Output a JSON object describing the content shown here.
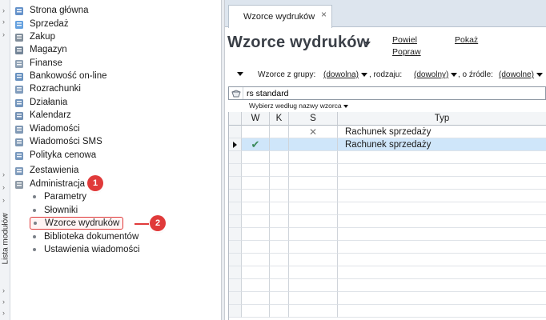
{
  "side_strip": {
    "label": "Lista modułów"
  },
  "modules": [
    {
      "label": "Strona główna",
      "icon": "home-icon",
      "color": "#4a7fc1"
    },
    {
      "label": "Sprzedaż",
      "icon": "sales-icon",
      "color": "#4a90d9"
    },
    {
      "label": "Zakup",
      "icon": "purchase-icon",
      "color": "#6b7a8a"
    },
    {
      "label": "Magazyn",
      "icon": "warehouse-icon",
      "color": "#5a6f85"
    },
    {
      "label": "Finanse",
      "icon": "finance-icon",
      "color": "#7a8fa6"
    },
    {
      "label": "Bankowość on-line",
      "icon": "bank-icon",
      "color": "#4f7fb5"
    },
    {
      "label": "Rozrachunki",
      "icon": "settlements-icon",
      "color": "#6a8bb0"
    },
    {
      "label": "Działania",
      "icon": "actions-icon",
      "color": "#5b82b0"
    },
    {
      "label": "Kalendarz",
      "icon": "calendar-icon",
      "color": "#5a7ea8"
    },
    {
      "label": "Wiadomości",
      "icon": "messages-icon",
      "color": "#6a87a8"
    },
    {
      "label": "Wiadomości SMS",
      "icon": "sms-icon",
      "color": "#6a87a8"
    },
    {
      "label": "Polityka cenowa",
      "icon": "pricing-icon",
      "color": "#5f86b3"
    },
    {
      "label": "Zestawienia",
      "icon": "reports-icon",
      "color": "#6a8bb0"
    },
    {
      "label": "Administracja",
      "icon": "admin-icon",
      "color": "#7a8898"
    }
  ],
  "admin_subitems": [
    "Parametry",
    "Słowniki",
    "Wzorce wydruków",
    "Biblioteka dokumentów",
    "Ustawienia wiadomości"
  ],
  "annotations": {
    "badge1": "1",
    "badge2": "2",
    "color": "#e03a3a"
  },
  "tab": {
    "label": "Wzorce wydruków",
    "close": "×"
  },
  "page": {
    "title": "Wzorce wydruków",
    "actions": {
      "powiel": "Powiel",
      "popraw": "Popraw",
      "pokaz": "Pokaż"
    }
  },
  "filters": {
    "group_label": "Wzorce z grupy:",
    "group_value": "(dowolna)",
    "kind_label": ", rodzaju:",
    "kind_value": "(dowolny)",
    "source_label": ", o źródle:",
    "source_value": "(dowolne)"
  },
  "search": {
    "value": "rs standard",
    "hint": "Wybierz według nazwy wzorca"
  },
  "grid": {
    "columns": [
      "W",
      "K",
      "S",
      "Typ"
    ],
    "rows": [
      {
        "w": "",
        "k": "",
        "s": "✕",
        "typ": "Rachunek sprzedaży",
        "selected": false
      },
      {
        "w": "✔",
        "k": "",
        "s": "",
        "typ": "Rachunek sprzedaży",
        "selected": true
      }
    ],
    "selected_row_color": "#cfe6fa",
    "check_color": "#3a8a5a"
  }
}
